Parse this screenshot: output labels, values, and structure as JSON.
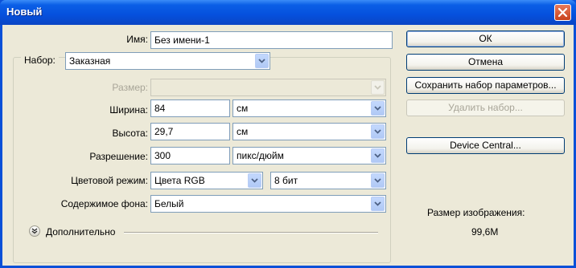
{
  "window": {
    "title": "Новый",
    "close_icon": "close-icon"
  },
  "form": {
    "name_label": "Имя:",
    "name_value": "Без имени-1",
    "preset_label": "Набор:",
    "preset_value": "Заказная",
    "size_label": "Размер:",
    "size_value": "",
    "width_label": "Ширина:",
    "width_value": "84",
    "width_unit": "см",
    "height_label": "Высота:",
    "height_value": "29,7",
    "height_unit": "см",
    "resolution_label": "Разрешение:",
    "resolution_value": "300",
    "resolution_unit": "пикс/дюйм",
    "color_mode_label": "Цветовой режим:",
    "color_mode_value": "Цвета RGB",
    "bit_depth_value": "8 бит",
    "background_label": "Содержимое фона:",
    "background_value": "Белый",
    "advanced_label": "Дополнительно"
  },
  "buttons": {
    "ok": "ОК",
    "cancel": "Отмена",
    "save_preset": "Сохранить набор параметров...",
    "delete_preset": "Удалить набор...",
    "device_central": "Device Central..."
  },
  "image_size": {
    "label": "Размер изображения:",
    "value": "99,6M"
  },
  "colors": {
    "title_bar": "#0a50d8",
    "dialog_bg": "#ece9d8",
    "button_border": "#003c74"
  }
}
